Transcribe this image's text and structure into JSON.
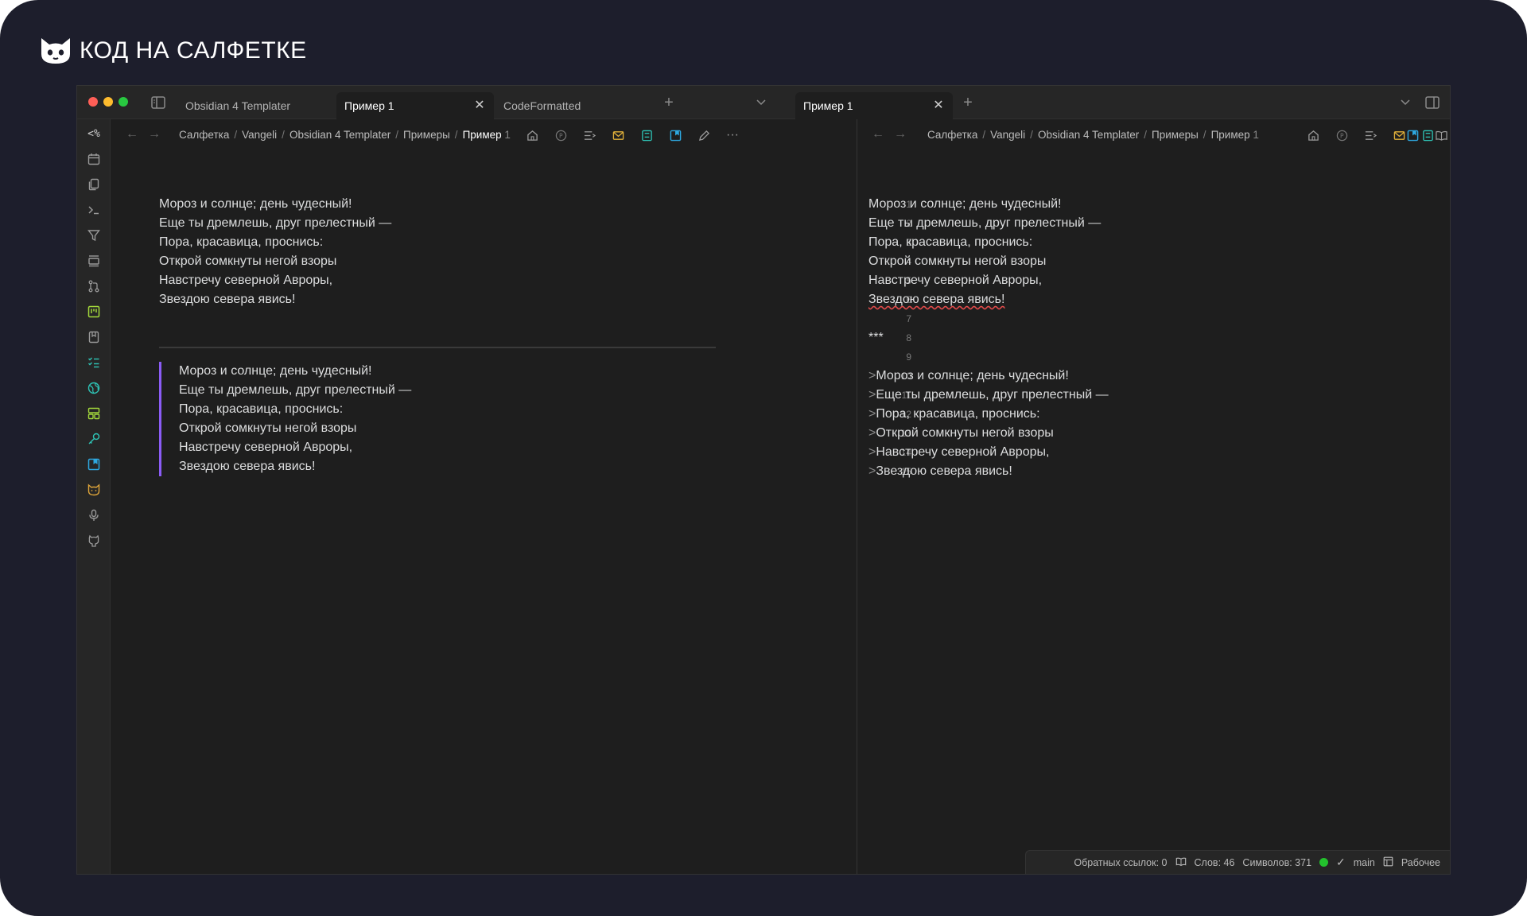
{
  "brand": {
    "name": "КОД НА САЛФЕТКЕ"
  },
  "tabs_left": [
    {
      "label": "Obsidian 4 Templater",
      "active": false
    },
    {
      "label": "Пример 1",
      "active": true
    },
    {
      "label": "CodeFormatted",
      "active": false
    }
  ],
  "tabs_right": [
    {
      "label": "Пример 1",
      "active": true
    }
  ],
  "ribbon_icons": [
    "templater-icon",
    "calendar-icon",
    "files-icon",
    "terminal-icon",
    "filter-icon",
    "slides-icon",
    "git-icon",
    "kanban-icon",
    "bookmark-icon",
    "tasks-icon",
    "globe-icon",
    "layout-icon",
    "key-icon",
    "bookmark-blue-icon",
    "cat-icon",
    "microphone-icon",
    "github-icon"
  ],
  "ribbon_top_label": "<%",
  "breadcrumb": {
    "items": [
      "Салфетка",
      "Vangeli",
      "Obsidian 4 Templater",
      "Примеры"
    ],
    "current": "Пример",
    "current_suffix": "1"
  },
  "poem": [
    "Мороз и солнце; день чудесный!",
    "Еще ты дремлешь, друг прелестный —",
    "Пора, красавица, проснись:",
    "Открой сомкнуты негой взоры",
    "Навстречу северной Авроры,",
    "Звездою севера явись!"
  ],
  "source": {
    "line_numbers": [
      "1",
      "2",
      "3",
      "4",
      "5",
      "6",
      "7",
      "8",
      "9",
      "10",
      "11",
      "12",
      "13",
      "14",
      "15"
    ],
    "hr_marker": "***",
    "quote_marker": ">"
  },
  "statusbar": {
    "backlinks": "Обратных ссылок: 0",
    "words": "Слов: 46",
    "chars": "Символов: 371",
    "branch": "main",
    "workspace": "Рабочее"
  },
  "colors": {
    "quote_border": "#8b5cf6",
    "status_ok": "#23c12d",
    "frame_bg": "#1d1e2c"
  }
}
